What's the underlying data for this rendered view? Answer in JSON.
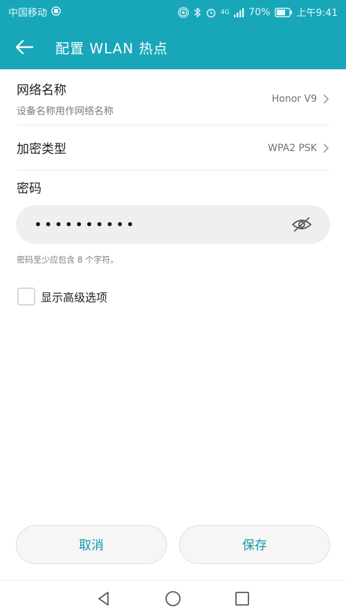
{
  "status_bar": {
    "carrier": "中国移动",
    "network": "4G",
    "battery": "70%",
    "time": "上午9:41"
  },
  "header": {
    "title": "配置 WLAN 热点"
  },
  "network_name": {
    "title": "网络名称",
    "subtitle": "设备名称用作网络名称",
    "value": "Honor V9"
  },
  "encryption": {
    "title": "加密类型",
    "value": "WPA2 PSK"
  },
  "password": {
    "label": "密码",
    "masked_value": "••••••••••",
    "hint": "密码至少应包含 8 个字符。"
  },
  "advanced": {
    "label": "显示高级选项",
    "checked": false
  },
  "buttons": {
    "cancel": "取消",
    "save": "保存"
  },
  "colors": {
    "accent": "#17a7b9",
    "button_text": "#139aa8"
  }
}
